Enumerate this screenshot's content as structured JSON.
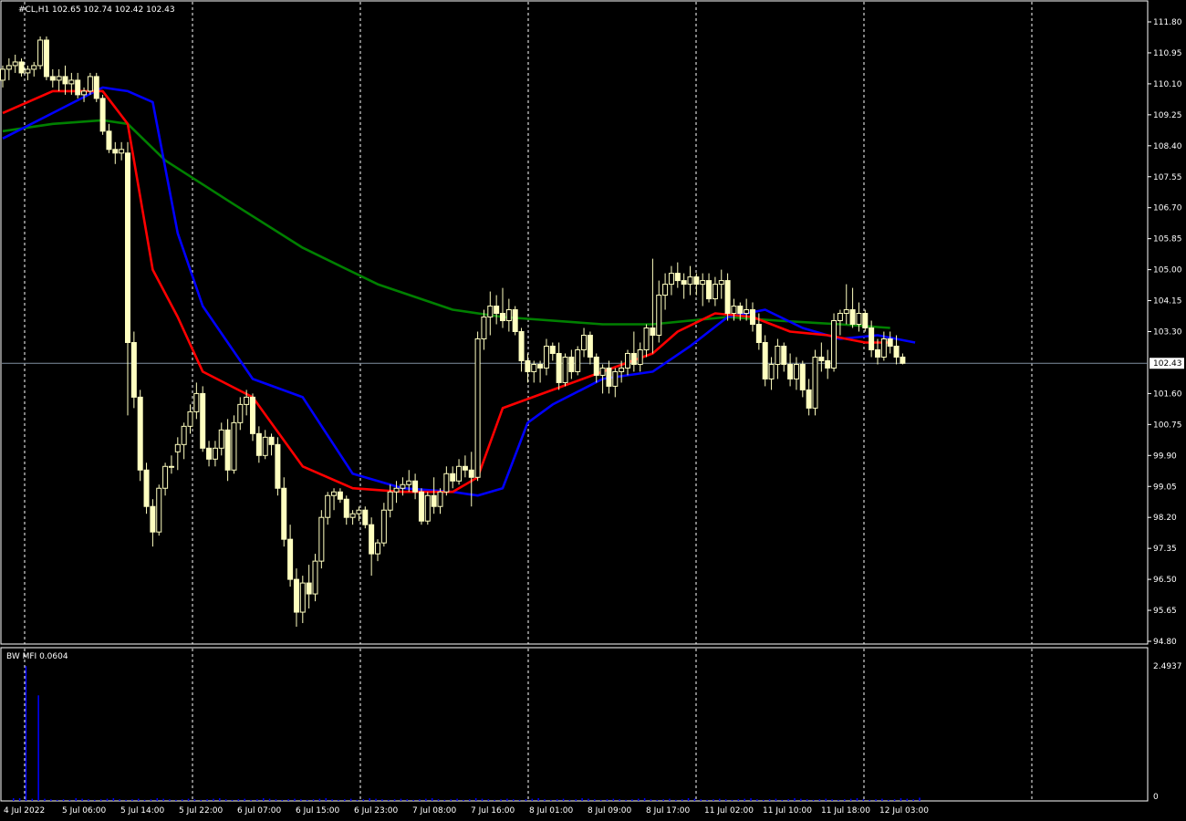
{
  "header": {
    "symbol_info": "#CL,H1  102.65 102.74 102.42 102.43"
  },
  "indicator": {
    "label": "BW MFI 0.0604",
    "axis_max": "2.4937",
    "axis_min": "0"
  },
  "colors": {
    "background": "#000000",
    "candle": "#ffffc0",
    "grid": "#ffffff",
    "ma_fast": "#ff0000",
    "ma_mid": "#0000ff",
    "ma_slow": "#008000",
    "histogram": "#0000ff",
    "price_line": "#8090a0"
  },
  "chart_data": {
    "type": "candlestick",
    "symbol": "#CL",
    "timeframe": "H1",
    "last_price": 102.43,
    "ylim": [
      94.8,
      111.8
    ],
    "y_ticks": [
      "111.80",
      "110.95",
      "110.10",
      "109.25",
      "108.40",
      "107.55",
      "106.70",
      "105.85",
      "105.00",
      "104.15",
      "103.30",
      "102.43",
      "101.60",
      "100.75",
      "99.90",
      "99.05",
      "98.20",
      "97.35",
      "96.50",
      "95.65",
      "94.80"
    ],
    "x_ticks": [
      "4 Jul 2022",
      "5 Jul 06:00",
      "5 Jul 14:00",
      "5 Jul 22:00",
      "6 Jul 07:00",
      "6 Jul 15:00",
      "6 Jul 23:00",
      "7 Jul 08:00",
      "7 Jul 16:00",
      "8 Jul 01:00",
      "8 Jul 09:00",
      "8 Jul 17:00",
      "11 Jul 02:00",
      "11 Jul 10:00",
      "11 Jul 18:00",
      "12 Jul 03:00"
    ],
    "candles": [
      [
        110.2,
        110.6,
        110.0,
        110.5
      ],
      [
        110.5,
        110.8,
        110.2,
        110.6
      ],
      [
        110.6,
        110.9,
        110.4,
        110.7
      ],
      [
        110.7,
        110.8,
        110.3,
        110.4
      ],
      [
        110.4,
        110.6,
        110.2,
        110.5
      ],
      [
        110.5,
        110.7,
        110.3,
        110.6
      ],
      [
        110.6,
        111.4,
        110.5,
        111.3
      ],
      [
        111.3,
        111.4,
        110.2,
        110.3
      ],
      [
        110.3,
        110.5,
        110.0,
        110.2
      ],
      [
        110.2,
        110.5,
        109.9,
        110.3
      ],
      [
        110.3,
        110.6,
        109.8,
        110.1
      ],
      [
        110.1,
        110.4,
        109.8,
        110.2
      ],
      [
        110.2,
        110.4,
        109.7,
        109.8
      ],
      [
        109.8,
        110.0,
        109.6,
        109.9
      ],
      [
        109.9,
        110.4,
        109.8,
        110.3
      ],
      [
        110.3,
        110.4,
        109.6,
        109.7
      ],
      [
        109.7,
        109.8,
        108.7,
        108.8
      ],
      [
        108.8,
        109.0,
        108.2,
        108.3
      ],
      [
        108.3,
        108.5,
        107.9,
        108.2
      ],
      [
        108.2,
        108.5,
        108.0,
        108.3
      ],
      [
        108.2,
        108.5,
        101.0,
        103.0
      ],
      [
        103.0,
        103.3,
        101.2,
        101.5
      ],
      [
        101.5,
        101.7,
        99.2,
        99.5
      ],
      [
        99.5,
        99.7,
        98.3,
        98.5
      ],
      [
        98.5,
        98.7,
        97.4,
        97.8
      ],
      [
        97.8,
        99.1,
        97.7,
        99.0
      ],
      [
        99.0,
        99.7,
        98.8,
        99.6
      ],
      [
        99.6,
        99.9,
        99.4,
        99.6
      ],
      [
        100.0,
        100.4,
        99.5,
        100.2
      ],
      [
        100.2,
        100.8,
        99.8,
        100.7
      ],
      [
        100.7,
        101.3,
        100.5,
        101.1
      ],
      [
        101.1,
        101.9,
        100.9,
        101.6
      ],
      [
        101.6,
        101.8,
        100.0,
        100.1
      ],
      [
        100.1,
        100.3,
        99.6,
        99.8
      ],
      [
        99.8,
        100.3,
        99.6,
        100.1
      ],
      [
        100.1,
        100.8,
        99.9,
        100.6
      ],
      [
        100.6,
        100.9,
        99.2,
        99.5
      ],
      [
        99.5,
        101.0,
        99.4,
        100.8
      ],
      [
        100.8,
        101.5,
        100.6,
        101.3
      ],
      [
        101.3,
        101.7,
        101.0,
        101.5
      ],
      [
        101.5,
        101.6,
        100.3,
        100.5
      ],
      [
        100.5,
        100.7,
        99.7,
        99.9
      ],
      [
        99.9,
        100.6,
        99.8,
        100.4
      ],
      [
        100.4,
        100.5,
        99.9,
        100.2
      ],
      [
        100.2,
        100.4,
        98.8,
        99.0
      ],
      [
        99.0,
        99.3,
        97.4,
        97.6
      ],
      [
        97.6,
        98.0,
        96.3,
        96.5
      ],
      [
        96.5,
        96.8,
        95.2,
        95.6
      ],
      [
        95.6,
        96.6,
        95.3,
        96.4
      ],
      [
        96.4,
        96.9,
        95.7,
        96.1
      ],
      [
        96.1,
        97.2,
        95.9,
        97.0
      ],
      [
        97.0,
        98.4,
        96.8,
        98.2
      ],
      [
        98.2,
        98.9,
        98.0,
        98.8
      ],
      [
        98.8,
        99.0,
        98.4,
        98.9
      ],
      [
        98.9,
        99.0,
        98.6,
        98.7
      ],
      [
        98.7,
        98.8,
        98.0,
        98.2
      ],
      [
        98.2,
        98.4,
        98.0,
        98.3
      ],
      [
        98.3,
        98.5,
        98.1,
        98.4
      ],
      [
        98.4,
        98.5,
        97.9,
        98.0
      ],
      [
        98.0,
        98.2,
        96.6,
        97.2
      ],
      [
        97.2,
        97.6,
        97.0,
        97.5
      ],
      [
        97.5,
        98.6,
        97.4,
        98.4
      ],
      [
        98.4,
        99.1,
        98.2,
        98.9
      ],
      [
        98.9,
        99.2,
        98.6,
        99.0
      ],
      [
        99.0,
        99.3,
        98.8,
        99.1
      ],
      [
        99.1,
        99.5,
        98.9,
        99.2
      ],
      [
        99.2,
        99.4,
        98.7,
        98.9
      ],
      [
        98.9,
        99.0,
        98.0,
        98.1
      ],
      [
        98.1,
        98.9,
        98.0,
        98.8
      ],
      [
        98.8,
        99.3,
        98.3,
        98.5
      ],
      [
        98.5,
        99.0,
        98.3,
        98.9
      ],
      [
        98.9,
        99.6,
        98.8,
        99.4
      ],
      [
        99.4,
        99.6,
        99.0,
        99.2
      ],
      [
        99.2,
        99.8,
        99.1,
        99.6
      ],
      [
        99.6,
        99.9,
        99.3,
        99.5
      ],
      [
        99.5,
        100.0,
        98.5,
        99.3
      ],
      [
        99.3,
        103.3,
        99.2,
        103.1
      ],
      [
        103.1,
        103.9,
        102.8,
        103.7
      ],
      [
        103.7,
        104.4,
        103.2,
        104.0
      ],
      [
        104.0,
        104.3,
        103.5,
        103.8
      ],
      [
        103.8,
        104.5,
        103.4,
        103.6
      ],
      [
        103.6,
        104.2,
        103.3,
        103.9
      ],
      [
        103.9,
        104.0,
        103.2,
        103.3
      ],
      [
        103.3,
        103.4,
        102.2,
        102.5
      ],
      [
        102.5,
        102.7,
        101.9,
        102.2
      ],
      [
        102.2,
        102.5,
        101.9,
        102.4
      ],
      [
        102.4,
        102.5,
        101.9,
        102.3
      ],
      [
        102.3,
        103.1,
        102.1,
        102.9
      ],
      [
        102.9,
        103.0,
        102.5,
        102.7
      ],
      [
        102.7,
        103.0,
        101.7,
        101.9
      ],
      [
        101.9,
        102.7,
        101.8,
        102.6
      ],
      [
        102.6,
        102.8,
        102.0,
        102.2
      ],
      [
        102.2,
        102.9,
        102.1,
        102.8
      ],
      [
        102.8,
        103.4,
        102.6,
        103.2
      ],
      [
        103.2,
        103.3,
        102.4,
        102.6
      ],
      [
        102.6,
        102.7,
        101.9,
        102.1
      ],
      [
        102.1,
        102.4,
        101.6,
        102.3
      ],
      [
        102.3,
        102.5,
        101.6,
        101.8
      ],
      [
        101.8,
        102.3,
        101.5,
        102.2
      ],
      [
        102.2,
        102.5,
        101.9,
        102.3
      ],
      [
        102.3,
        102.8,
        102.1,
        102.7
      ],
      [
        102.7,
        103.3,
        102.2,
        102.4
      ],
      [
        102.4,
        103.0,
        102.2,
        102.8
      ],
      [
        102.8,
        103.5,
        102.6,
        103.4
      ],
      [
        103.4,
        105.3,
        102.7,
        103.2
      ],
      [
        103.2,
        104.7,
        103.0,
        104.3
      ],
      [
        104.3,
        104.9,
        103.9,
        104.6
      ],
      [
        104.6,
        105.1,
        104.3,
        104.9
      ],
      [
        104.9,
        105.2,
        104.5,
        104.7
      ],
      [
        104.7,
        104.9,
        104.2,
        104.6
      ],
      [
        104.6,
        105.1,
        104.3,
        104.8
      ],
      [
        104.8,
        104.9,
        104.3,
        104.6
      ],
      [
        104.6,
        104.9,
        104.0,
        104.7
      ],
      [
        104.7,
        104.9,
        104.1,
        104.2
      ],
      [
        104.2,
        104.8,
        104.0,
        104.6
      ],
      [
        104.6,
        105.0,
        104.2,
        104.7
      ],
      [
        104.7,
        104.9,
        103.6,
        103.8
      ],
      [
        103.8,
        104.2,
        103.6,
        104.0
      ],
      [
        104.0,
        104.1,
        103.6,
        103.8
      ],
      [
        103.8,
        104.2,
        103.6,
        103.9
      ],
      [
        103.9,
        104.1,
        103.3,
        103.5
      ],
      [
        103.5,
        103.8,
        102.8,
        103.0
      ],
      [
        103.0,
        103.2,
        101.8,
        102.0
      ],
      [
        102.0,
        102.6,
        101.7,
        102.4
      ],
      [
        102.4,
        103.1,
        102.0,
        102.9
      ],
      [
        102.9,
        103.0,
        102.2,
        102.4
      ],
      [
        102.4,
        102.7,
        101.8,
        102.0
      ],
      [
        102.0,
        102.6,
        101.7,
        102.4
      ],
      [
        102.4,
        102.5,
        101.5,
        101.7
      ],
      [
        101.7,
        102.0,
        101.0,
        101.2
      ],
      [
        101.2,
        102.8,
        101.0,
        102.6
      ],
      [
        102.6,
        103.0,
        102.2,
        102.5
      ],
      [
        102.5,
        102.8,
        102.0,
        102.3
      ],
      [
        102.3,
        103.8,
        102.2,
        103.6
      ],
      [
        103.6,
        103.9,
        103.2,
        103.8
      ],
      [
        103.8,
        104.6,
        103.5,
        103.9
      ],
      [
        103.9,
        104.5,
        103.4,
        103.5
      ],
      [
        103.5,
        104.1,
        103.3,
        103.8
      ],
      [
        103.8,
        103.9,
        103.3,
        103.4
      ],
      [
        103.4,
        103.6,
        102.6,
        102.8
      ],
      [
        102.8,
        103.1,
        102.4,
        102.6
      ],
      [
        102.6,
        103.3,
        102.5,
        103.1
      ],
      [
        103.1,
        103.3,
        102.7,
        102.9
      ],
      [
        102.9,
        103.2,
        102.4,
        102.6
      ],
      [
        102.6,
        102.7,
        102.4,
        102.43
      ]
    ],
    "ma_fast": [
      [
        0,
        109.3
      ],
      [
        8,
        109.9
      ],
      [
        16,
        109.9
      ],
      [
        20,
        109.0
      ],
      [
        24,
        105.0
      ],
      [
        28,
        103.7
      ],
      [
        32,
        102.2
      ],
      [
        40,
        101.5
      ],
      [
        48,
        99.6
      ],
      [
        56,
        99.0
      ],
      [
        64,
        98.9
      ],
      [
        72,
        98.9
      ],
      [
        76,
        99.3
      ],
      [
        80,
        101.2
      ],
      [
        88,
        101.7
      ],
      [
        96,
        102.2
      ],
      [
        104,
        102.7
      ],
      [
        108,
        103.3
      ],
      [
        114,
        103.8
      ],
      [
        120,
        103.7
      ],
      [
        126,
        103.3
      ],
      [
        132,
        103.2
      ],
      [
        138,
        103.0
      ],
      [
        142,
        103.0
      ]
    ],
    "ma_mid": [
      [
        0,
        108.6
      ],
      [
        8,
        109.3
      ],
      [
        16,
        110.0
      ],
      [
        20,
        109.9
      ],
      [
        24,
        109.6
      ],
      [
        28,
        106.0
      ],
      [
        32,
        104.0
      ],
      [
        40,
        102.0
      ],
      [
        48,
        101.5
      ],
      [
        56,
        99.4
      ],
      [
        64,
        99.0
      ],
      [
        72,
        98.9
      ],
      [
        76,
        98.8
      ],
      [
        80,
        99.0
      ],
      [
        84,
        100.8
      ],
      [
        88,
        101.3
      ],
      [
        96,
        102.0
      ],
      [
        104,
        102.2
      ],
      [
        110,
        102.9
      ],
      [
        116,
        103.7
      ],
      [
        122,
        103.9
      ],
      [
        128,
        103.4
      ],
      [
        134,
        103.1
      ],
      [
        140,
        103.2
      ],
      [
        146,
        103.0
      ]
    ],
    "ma_slow": [
      [
        0,
        108.8
      ],
      [
        8,
        109.0
      ],
      [
        16,
        109.1
      ],
      [
        20,
        109.0
      ],
      [
        26,
        108.0
      ],
      [
        36,
        106.9
      ],
      [
        48,
        105.6
      ],
      [
        60,
        104.6
      ],
      [
        72,
        103.9
      ],
      [
        80,
        103.7
      ],
      [
        96,
        103.5
      ],
      [
        104,
        103.5
      ],
      [
        116,
        103.7
      ],
      [
        124,
        103.6
      ],
      [
        134,
        103.5
      ],
      [
        142,
        103.4
      ]
    ],
    "bw_mfi": {
      "value": 0.0604,
      "max": 2.4937,
      "bars": [
        0.05,
        0.05,
        2.49,
        0.04,
        1.95,
        0.04,
        0.03,
        0.02,
        0.03,
        0.02,
        0.05,
        0.04,
        0.03,
        0.02,
        0.03,
        0.04,
        0.05,
        0.03,
        0.02,
        0.03,
        0.04,
        0.02,
        0.03,
        0.05,
        0.04,
        0.03,
        0.02,
        0.03,
        0.04,
        0.03,
        0.02,
        0.03,
        0.04,
        0.05,
        0.03,
        0.02,
        0.03,
        0.04,
        0.02,
        0.03,
        0.05,
        0.04,
        0.03,
        0.02,
        0.03,
        0.04,
        0.03,
        0.02,
        0.03,
        0.04,
        0.05,
        0.03,
        0.02,
        0.03,
        0.04,
        0.02,
        0.03,
        0.05,
        0.04,
        0.03,
        0.02,
        0.03,
        0.04,
        0.03,
        0.02,
        0.03,
        0.04,
        0.05,
        0.03,
        0.02,
        0.03,
        0.04,
        0.02,
        0.03,
        0.05,
        0.04,
        0.03,
        0.02,
        0.03,
        0.04,
        0.03,
        0.02,
        0.03,
        0.04,
        0.05,
        0.03,
        0.02,
        0.03,
        0.04,
        0.02,
        0.03,
        0.05,
        0.04,
        0.03,
        0.02,
        0.03,
        0.04,
        0.03,
        0.02,
        0.03,
        0.04,
        0.05,
        0.03,
        0.02,
        0.03,
        0.04,
        0.02,
        0.03,
        0.05,
        0.04,
        0.03,
        0.02,
        0.03,
        0.04,
        0.03,
        0.02,
        0.03,
        0.04,
        0.05,
        0.03,
        0.02,
        0.03,
        0.04,
        0.02,
        0.03,
        0.05,
        0.04,
        0.03,
        0.02,
        0.03,
        0.04,
        0.03,
        0.02,
        0.03,
        0.04,
        0.05,
        0.03,
        0.02,
        0.03,
        0.04,
        0.02,
        0.03,
        0.05,
        0.04,
        0.03,
        0.06
      ]
    }
  }
}
